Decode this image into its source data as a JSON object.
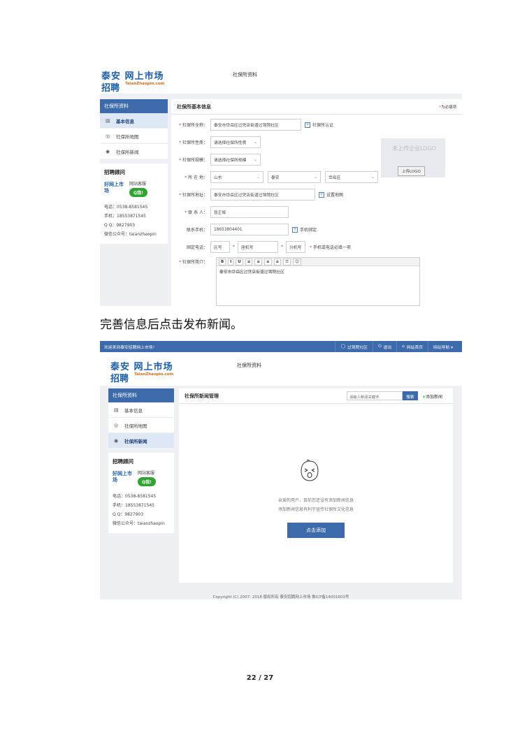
{
  "brand": {
    "line1": "泰安 网上市场",
    "line2": "招聘",
    "sub": "TaianZhaopin.com"
  },
  "page_title": "社保所资料",
  "sidebar": {
    "header": "社保所资料",
    "items": [
      {
        "label": "基本信息"
      },
      {
        "label": "社保所地图"
      },
      {
        "label": "社保所新闻"
      }
    ],
    "contact": {
      "title": "招聘顾问",
      "site_service": "网站客服",
      "qq_button": "Q我!",
      "lines": [
        "电话：0538-8581545",
        "手机：18553871545",
        "Q Q：9827903",
        "微信公众号：taianzhaopin"
      ]
    }
  },
  "form": {
    "title": "社保所基本信息",
    "required_note": "为必填项",
    "fields": {
      "fullname": {
        "label": "社保所全称：",
        "value": "泰安市岱岳区过凭店街道过驾院社区",
        "link": "社保所认证"
      },
      "nature": {
        "label": "社保所性质：",
        "placeholder": "请选择社保所性质"
      },
      "scale": {
        "label": "社保所规模：",
        "placeholder": "请选择社保所规模"
      },
      "location": {
        "label": "所 在 地：",
        "province": "山东",
        "city": "泰安",
        "district": "岱岳区"
      },
      "address": {
        "label": "社保所地址：",
        "value": "泰安市岱岳区过凭店街道过驾院社区",
        "link": "设置地图"
      },
      "contact": {
        "label": "联 系 人：",
        "value": "张正辉"
      },
      "mobile": {
        "label": "联系手机：",
        "value": "18653804401",
        "link": "手机绑定"
      },
      "phone": {
        "label": "固定电话：",
        "area": "区号",
        "number": "座机号",
        "ext": "分机号",
        "note": "手机或电话必填一项"
      },
      "intro": {
        "label": "社保所简介：",
        "value": "泰安市岱岳区过凭店街道过驾院社区"
      }
    },
    "logo": {
      "placeholder": "未上传企业LOGO",
      "upload": "上传LOGO"
    },
    "toolbar": [
      "B",
      "I",
      "U",
      "≡",
      "≡",
      "≡",
      "≡",
      "☰",
      "☺"
    ]
  },
  "caption": "完善信息后点击发布新闻。",
  "news": {
    "topbar": {
      "welcome": "欢迎来到泰安招聘网上市场！",
      "items": [
        "过驾院社区",
        "退出",
        "网站首页",
        "网站导航 ▾"
      ]
    },
    "title": "社保所新闻管理",
    "search_placeholder": "请输入新闻关键字",
    "search_button": "搜索",
    "add_link": "添加新闻",
    "empty_line1": "亲爱的用户，目前您还没有添加新闻信息",
    "empty_line2": "添加新闻信息有利于宣传社保所文化信息",
    "add_button": "点击添加",
    "footer": "Copyright (C) 2007- 2018 版权所有 泰安招聘网上市场 鲁ICP备14001603号"
  },
  "page_number": "22 / 27",
  "colors": {
    "accent": "#3c6aaa",
    "required": "#d33333",
    "qq_green": "#2fa52f"
  }
}
